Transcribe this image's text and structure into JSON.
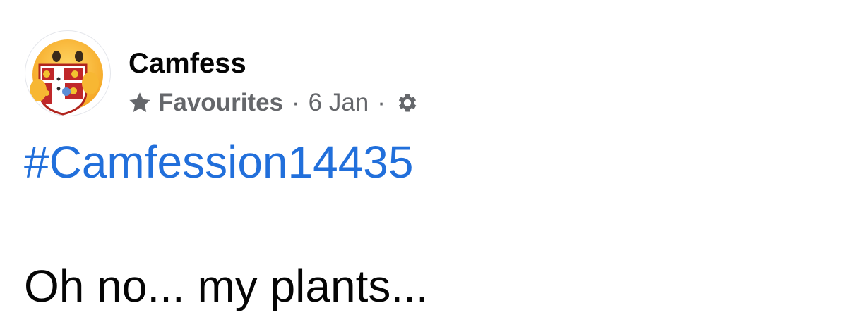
{
  "post": {
    "author": "Camfess",
    "audience": "Favourites",
    "separator": "·",
    "date": "6 Jan",
    "hashtag": "#Camfession14435",
    "text": "Oh no... my plants..."
  },
  "icons": {
    "avatar": "care-emoji-hugging-crest",
    "audience": "star-icon",
    "settings": "gear-icon"
  },
  "colors": {
    "hashtag": "#216fdb",
    "meta": "#65676b",
    "text": "#050505"
  }
}
